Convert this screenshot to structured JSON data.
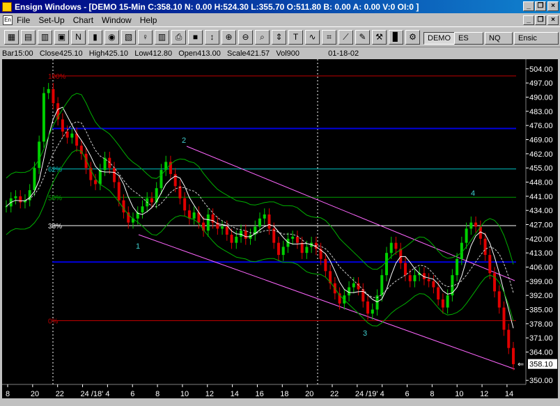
{
  "window": {
    "title": "Ensign Windows - [DEMO 15-Min C:358.10 N: 0.00 H:524.30 L:355.70 O:511.80 B: 0.00 A: 0.00 V:0 OI:0 ]",
    "minimize": "_",
    "restore": "❐",
    "close": "×"
  },
  "menu": {
    "items": [
      "File",
      "Set-Up",
      "Chart",
      "Window",
      "Help"
    ]
  },
  "toolbar": {
    "symbol_tabs": [
      "DEMO",
      "ES",
      "NQ",
      "Ensic"
    ]
  },
  "infobar": {
    "bar_label": "Bar",
    "bar": "15:00",
    "close_label": "Close",
    "close": "425.10",
    "high_label": "High",
    "high": "425.10",
    "low_label": "Low",
    "low": "412.80",
    "open_label": "Open",
    "open": "413.00",
    "scale_label": "Scale",
    "scale": "421.57",
    "vol_label": "Vol",
    "vol": "900",
    "date": "01-18-02"
  },
  "chart_data": {
    "type": "candlestick",
    "ylim": [
      348,
      506
    ],
    "y_ticks": [
      "504.00",
      "497.00",
      "490.00",
      "483.00",
      "476.00",
      "469.00",
      "462.00",
      "455.00",
      "448.00",
      "441.00",
      "434.00",
      "427.00",
      "420.00",
      "413.00",
      "406.00",
      "399.00",
      "392.00",
      "385.00",
      "378.00",
      "371.00",
      "364.00",
      "358.10",
      "350.00"
    ],
    "last_price": "358.10",
    "x_ticks": [
      "8",
      "20",
      "22",
      "24 /18'",
      "4",
      "6",
      "8",
      "10",
      "12",
      "14",
      "16",
      "18",
      "20",
      "22",
      "24 /19'",
      "4",
      "6",
      "8",
      "10",
      "12",
      "14"
    ],
    "fib_levels": [
      {
        "label": "100%",
        "price": 500.5,
        "color": "#c00000"
      },
      {
        "label": "",
        "price": 474.5,
        "color": "#0000e0"
      },
      {
        "label": "62%",
        "price": 454.5,
        "color": "#00c0c0"
      },
      {
        "label": "50%",
        "price": 440.5,
        "color": "#00a000"
      },
      {
        "label": "38%",
        "price": 426.5,
        "color": "#ffffff"
      },
      {
        "label": "",
        "price": 408.5,
        "color": "#0000e0"
      },
      {
        "label": "0%",
        "price": 379.5,
        "color": "#c00000"
      }
    ],
    "wave_labels": [
      "1",
      "2",
      "3",
      "4"
    ],
    "series": [
      {
        "name": "price",
        "values": [
          436,
          440,
          441,
          438,
          439,
          444,
          455,
          468,
          492,
          494,
          487,
          479,
          473,
          470,
          472,
          466,
          462,
          455,
          449,
          447,
          454,
          460,
          455,
          448,
          439,
          433,
          428,
          430,
          433,
          436,
          440,
          438,
          445,
          454,
          458,
          452,
          446,
          440,
          434,
          430,
          433,
          428,
          424,
          432,
          428,
          425,
          426,
          422,
          418,
          421,
          424,
          420,
          422,
          426,
          430,
          432,
          425,
          418,
          412,
          416,
          420,
          421,
          418,
          413,
          416,
          418,
          415,
          410,
          404,
          398,
          393,
          388,
          392,
          396,
          398,
          395,
          389,
          383,
          385,
          392,
          402,
          413,
          418,
          415,
          408,
          402,
          399,
          402,
          403,
          400,
          399,
          396,
          390,
          386,
          392,
          402,
          410,
          418,
          425,
          428,
          426,
          420,
          412,
          403,
          394,
          386,
          375,
          366,
          358
        ]
      }
    ]
  }
}
